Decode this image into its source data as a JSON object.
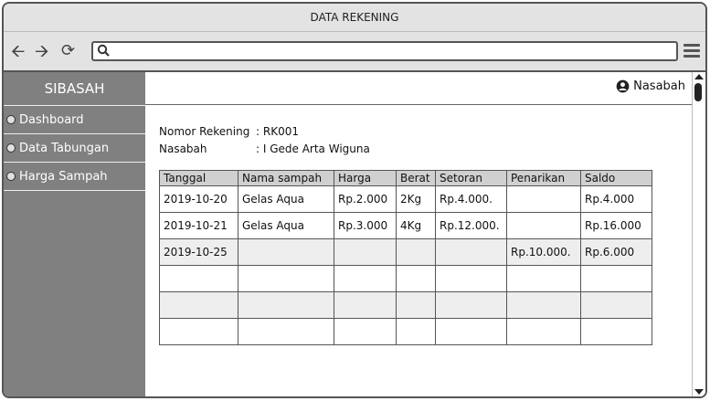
{
  "window": {
    "title": "DATA REKENING"
  },
  "toolbar": {
    "back_icon": "arrow-left-icon",
    "forward_icon": "arrow-right-icon",
    "reload_icon": "reload-icon",
    "url_value": "",
    "url_placeholder": "",
    "menu_icon": "hamburger-menu-icon"
  },
  "sidebar": {
    "brand": "SIBASAH",
    "items": [
      {
        "label": "Dashboard"
      },
      {
        "label": "Data Tabungan"
      },
      {
        "label": "Harga Sampah"
      }
    ]
  },
  "header": {
    "user_label": "Nasabah",
    "user_icon": "user-circle-icon"
  },
  "account": {
    "nomor_label": "Nomor Rekening",
    "nomor_value": ": RK001",
    "nasabah_label": "Nasabah",
    "nasabah_value": ": I Gede Arta Wiguna"
  },
  "table": {
    "columns": [
      "Tanggal",
      "Nama sampah",
      "Harga",
      "Berat",
      "Setoran",
      "Penarikan",
      "Saldo"
    ],
    "rows": [
      [
        "2019-10-20",
        "Gelas Aqua",
        "Rp.2.000",
        "2Kg",
        "Rp.4.000.",
        "",
        "Rp.4.000"
      ],
      [
        "2019-10-21",
        "Gelas Aqua",
        "Rp.3.000",
        "4Kg",
        "Rp.12.000.",
        "",
        "Rp.16.000"
      ],
      [
        "2019-10-25",
        "",
        "",
        "",
        "",
        "Rp.10.000.",
        "Rp.6.000"
      ],
      [
        "",
        "",
        "",
        "",
        "",
        "",
        ""
      ],
      [
        "",
        "",
        "",
        "",
        "",
        "",
        ""
      ],
      [
        "",
        "",
        "",
        "",
        "",
        "",
        ""
      ]
    ]
  },
  "colors": {
    "sidebar_bg": "#808080",
    "header_bg": "#d0d0d0",
    "alt_row": "#eeeeee"
  }
}
